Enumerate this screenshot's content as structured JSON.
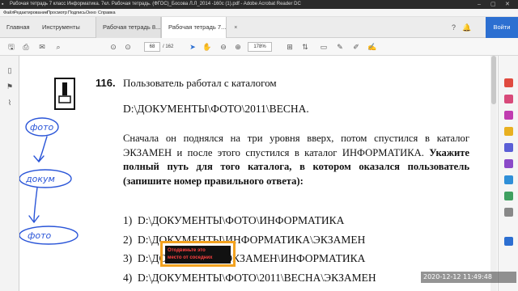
{
  "titlebar": {
    "title": "Рабочая тетрадь 7 класс Информатика. 7кл. Рабочая тетрадь. (ФГОС)_Босова Л.Л_2014 -160с (1).pdf - Adobe Acrobat Reader DC",
    "minimize": "–",
    "maximize": "▢",
    "close": "✕"
  },
  "menu": [
    "Файл",
    "Редактирование",
    "Просмотр",
    "Подпись",
    "Окно",
    "Справка"
  ],
  "tabs": [
    {
      "label": "Главная"
    },
    {
      "label": "Инструменты"
    },
    {
      "label": "Рабочая тетрадь 8...",
      "close": "×"
    },
    {
      "label": "Рабочая тетрадь 7...",
      "close": "×"
    }
  ],
  "login": "Войти",
  "toolbar": {
    "page_current": "68",
    "page_total": "/ 162",
    "zoom": "178%"
  },
  "document": {
    "task_number": "116.",
    "task_title": "Пользователь работал с каталогом",
    "path": "D:\\ДОКУМЕНТЫ\\ФОТО\\2011\\ВЕСНА.",
    "paragraph_normal": "Сначала он поднялся на три уровня вверх, потом спустился в каталог ЭКЗАМЕН и после этого спустился в каталог ИНФОРМАТИКА.",
    "paragraph_bold": "Укажите полный путь для того каталога, в котором оказался пользователь (запишите номер правильного ответа):",
    "options": [
      {
        "n": "1)",
        "text": "D:\\ДОКУМЕНТЫ\\ФОТО\\ИНФОРМАТИКА"
      },
      {
        "n": "2)",
        "text": "D:\\ДОКУМЕНТЫ\\ИНФОРМАТИКА\\ЭКЗАМЕН"
      },
      {
        "n": "3)",
        "text": "D:\\ДОКУМЕНТЫ\\ЭКЗАМЕН\\ИНФОРМАТИКА"
      },
      {
        "n": "4)",
        "text": "D:\\ДОКУМЕНТЫ\\ФОТО\\2011\\ВЕСНА\\ЭКЗАМЕН"
      }
    ],
    "annotations": [
      "фото",
      "докум",
      "фото"
    ]
  },
  "overlay": {
    "text": "Отодвиньте это",
    "text2": "место от соседних"
  },
  "timestamp": "2020-12-12  11:49:48",
  "colors": {
    "accent": "#2c6fd1",
    "overlay_border": "#f3a21f",
    "annotation_ink": "#2a55d8"
  }
}
